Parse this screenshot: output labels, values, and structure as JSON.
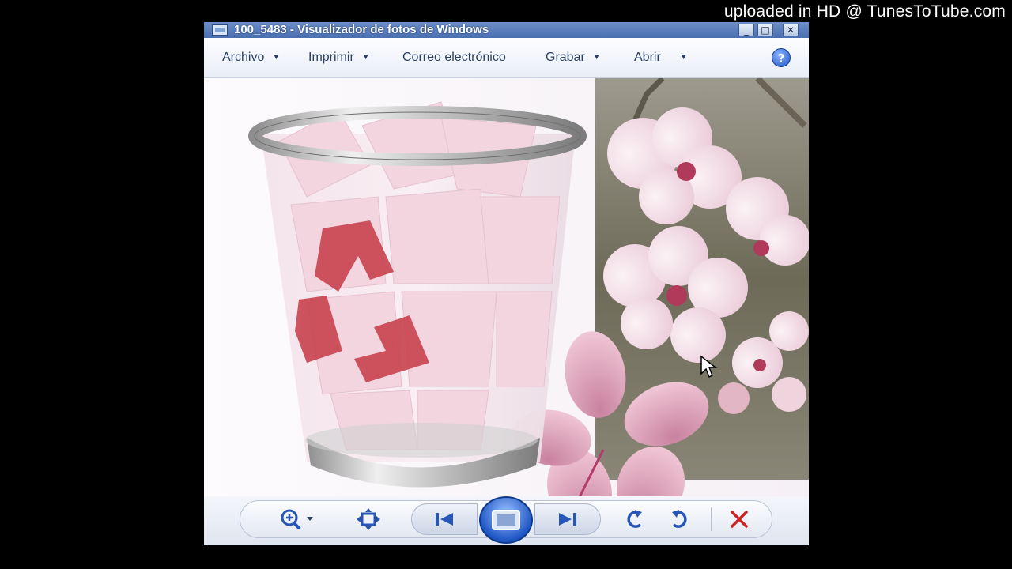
{
  "overlay": {
    "watermark": "uploaded in HD @ TunesToTube.com"
  },
  "window": {
    "title": "100_5483 - Visualizador de fotos de Windows",
    "buttons": {
      "minimize": "_",
      "maximize": "□",
      "close": "✕"
    }
  },
  "menu": {
    "items": [
      {
        "label": "Archivo",
        "has_dropdown": true
      },
      {
        "label": "Imprimir",
        "has_dropdown": true
      },
      {
        "label": "Correo electrónico",
        "has_dropdown": false
      },
      {
        "label": "Grabar",
        "has_dropdown": true
      },
      {
        "label": "Abrir",
        "has_dropdown": true
      }
    ],
    "help_icon_glyph": "?"
  },
  "controls": {
    "icons": [
      "zoom-icon",
      "fit-to-window-icon",
      "previous-icon",
      "slideshow-icon",
      "next-icon",
      "rotate-left-icon",
      "rotate-right-icon",
      "delete-icon"
    ],
    "colors": {
      "accent": "#1f56c4",
      "delete": "#cc2222",
      "recycle": "#c8434f"
    }
  }
}
